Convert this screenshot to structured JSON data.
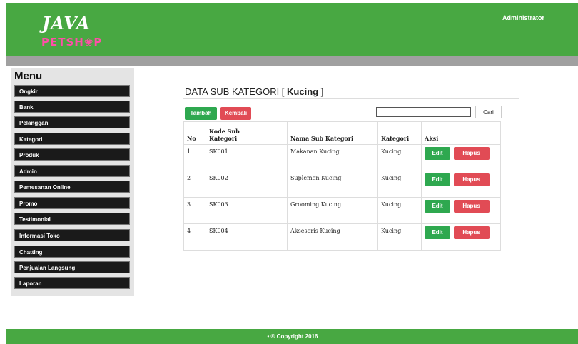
{
  "header": {
    "logo_top": "JAVA",
    "logo_bottom": "PETSH❀P",
    "user_label": "Administrator"
  },
  "sidebar": {
    "title": "Menu",
    "items": [
      {
        "label": "Ongkir"
      },
      {
        "label": "Bank"
      },
      {
        "label": "Pelanggan"
      },
      {
        "label": "Kategori"
      },
      {
        "label": "Produk"
      },
      {
        "label": "Admin"
      },
      {
        "label": "Pemesanan Online"
      },
      {
        "label": "Promo"
      },
      {
        "label": "Testimonial"
      },
      {
        "label": "Informasi Toko"
      },
      {
        "label": "Chatting"
      },
      {
        "label": "Penjualan Langsung"
      },
      {
        "label": "Laporan"
      }
    ]
  },
  "main": {
    "title_prefix": "DATA SUB KATEGORI [ ",
    "title_category": "Kucing",
    "title_suffix": " ]",
    "add_label": "Tambah",
    "back_label": "Kembali",
    "search_value": "",
    "search_button": "Cari",
    "columns": [
      "No",
      "Kode Sub Kategori",
      "Nama Sub Kategori",
      "Kategori",
      "Aksi"
    ],
    "rows": [
      {
        "no": "1",
        "kode": "SK001",
        "nama": "Makanan Kucing",
        "kategori": "Kucing",
        "edit": "Edit",
        "hapus": "Hapus"
      },
      {
        "no": "2",
        "kode": "SK002",
        "nama": "Suplemen Kucing",
        "kategori": "Kucing",
        "edit": "Edit",
        "hapus": "Hapus"
      },
      {
        "no": "3",
        "kode": "SK003",
        "nama": "Grooming Kucing",
        "kategori": "Kucing",
        "edit": "Edit",
        "hapus": "Hapus"
      },
      {
        "no": "4",
        "kode": "SK004",
        "nama": "Aksesoris Kucing",
        "kategori": "Kucing",
        "edit": "Edit",
        "hapus": "Hapus"
      }
    ]
  },
  "footer": {
    "text": "• © Copyright 2016"
  }
}
